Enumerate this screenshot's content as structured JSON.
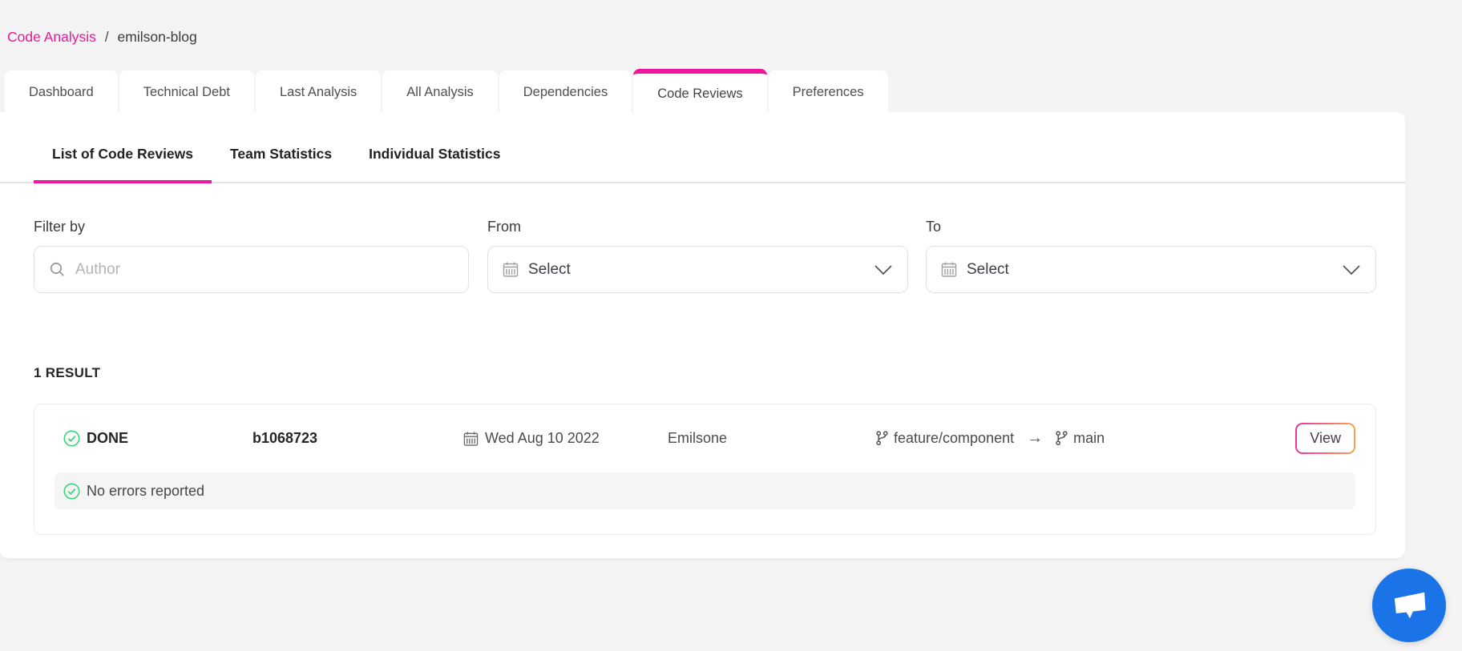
{
  "breadcrumb": {
    "parent": "Code Analysis",
    "separator": "/",
    "current": "emilson-blog"
  },
  "tabs": [
    {
      "label": "Dashboard"
    },
    {
      "label": "Technical Debt"
    },
    {
      "label": "Last Analysis"
    },
    {
      "label": "All Analysis"
    },
    {
      "label": "Dependencies"
    },
    {
      "label": "Code Reviews"
    },
    {
      "label": "Preferences"
    }
  ],
  "subtabs": [
    {
      "label": "List of Code Reviews"
    },
    {
      "label": "Team Statistics"
    },
    {
      "label": "Individual Statistics"
    }
  ],
  "filters": {
    "filter_by_label": "Filter by",
    "author_placeholder": "Author",
    "from_label": "From",
    "from_value": "Select",
    "to_label": "To",
    "to_value": "Select"
  },
  "results": {
    "count_label": "1 RESULT",
    "items": [
      {
        "status": "DONE",
        "commit": "b1068723",
        "date": "Wed Aug 10 2022",
        "author": "Emilsone",
        "source_branch": "feature/component",
        "arrow": "→",
        "target_branch": "main",
        "view_label": "View",
        "message": "No errors reported"
      }
    ]
  },
  "colors": {
    "accent_pink": "#f0169b",
    "success_green": "#3fd47c",
    "chat_blue": "#1a74e8",
    "view_gradient_start": "#f42fa0",
    "view_gradient_end": "#f8a44c"
  }
}
